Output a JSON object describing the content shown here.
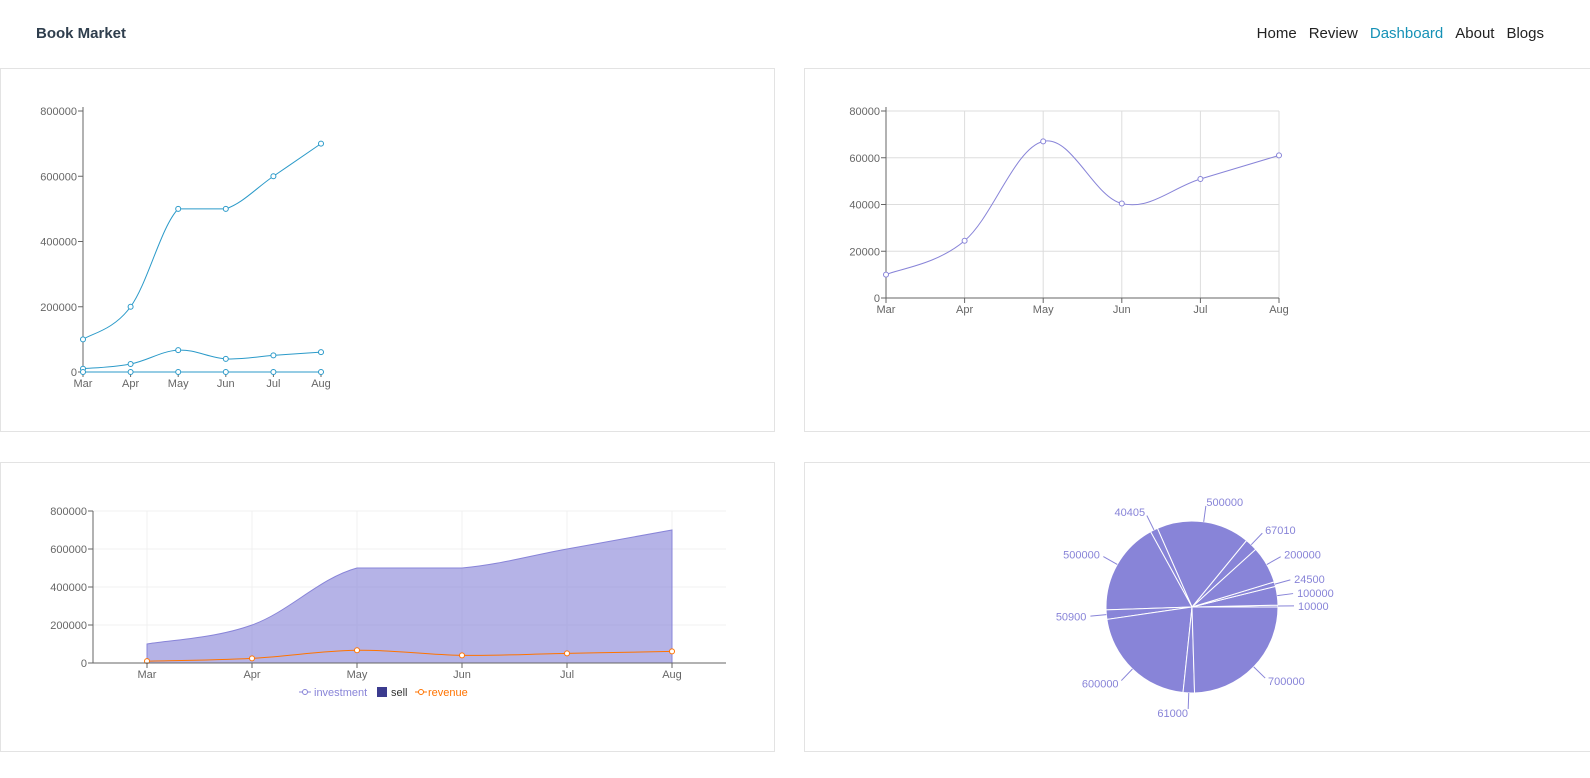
{
  "navbar": {
    "brand": "Book Market",
    "links": [
      {
        "label": "Home",
        "active": false
      },
      {
        "label": "Review",
        "active": false
      },
      {
        "label": "Dashboard",
        "active": true
      },
      {
        "label": "About",
        "active": false
      },
      {
        "label": "Blogs",
        "active": false
      }
    ]
  },
  "colors": {
    "accent": "#1591b6",
    "line_blue": "#2b9ac9",
    "purple": "#8884d8",
    "dark_navy": "#3b3b8f",
    "orange": "#ff7300"
  },
  "chart_data": [
    {
      "type": "line",
      "categories": [
        "Mar",
        "Apr",
        "May",
        "Jun",
        "Jul",
        "Aug"
      ],
      "ylim": [
        0,
        800000
      ],
      "yticks": [
        0,
        200000,
        400000,
        600000,
        800000
      ],
      "grid": false,
      "series": [
        {
          "values": [
            100000,
            200000,
            500000,
            500000,
            600000,
            700000
          ]
        },
        {
          "values": [
            10000,
            24500,
            67010,
            40405,
            50900,
            61000
          ]
        },
        {
          "values": [
            0,
            0,
            0,
            0,
            0,
            0
          ]
        }
      ]
    },
    {
      "type": "line",
      "categories": [
        "Mar",
        "Apr",
        "May",
        "Jun",
        "Jul",
        "Aug"
      ],
      "ylim": [
        0,
        80000
      ],
      "yticks": [
        0,
        20000,
        40000,
        60000,
        80000
      ],
      "grid": true,
      "series": [
        {
          "values": [
            10000,
            24500,
            67010,
            40405,
            50900,
            61000
          ]
        }
      ]
    },
    {
      "type": "area",
      "categories": [
        "Mar",
        "Apr",
        "May",
        "Jun",
        "Jul",
        "Aug"
      ],
      "ylim": [
        0,
        800000
      ],
      "yticks": [
        0,
        200000,
        400000,
        600000,
        800000
      ],
      "grid": true,
      "legend": "bottom",
      "series": [
        {
          "name": "investment",
          "type": "area",
          "values": [
            100000,
            200000,
            500000,
            500000,
            600000,
            700000
          ]
        },
        {
          "name": "sell",
          "type": "bar",
          "values": [
            0,
            0,
            0,
            0,
            0,
            0
          ]
        },
        {
          "name": "revenue",
          "type": "line",
          "values": [
            10000,
            24500,
            67010,
            40405,
            50900,
            61000
          ]
        }
      ]
    },
    {
      "type": "pie",
      "labels": [
        "10000",
        "100000",
        "24500",
        "200000",
        "67010",
        "500000",
        "40405",
        "500000",
        "50900",
        "600000",
        "61000",
        "700000"
      ],
      "values": [
        10000,
        100000,
        24500,
        200000,
        67010,
        500000,
        40405,
        500000,
        50900,
        600000,
        61000,
        700000
      ]
    }
  ]
}
